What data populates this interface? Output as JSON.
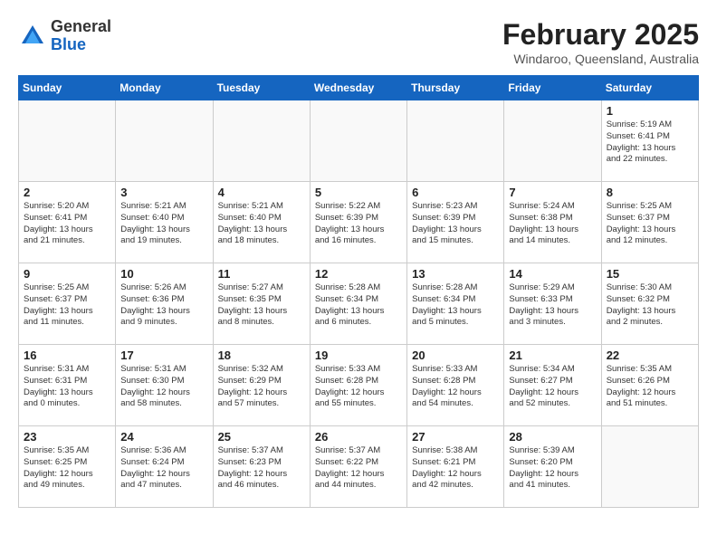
{
  "header": {
    "logo_general": "General",
    "logo_blue": "Blue",
    "month_title": "February 2025",
    "location": "Windaroo, Queensland, Australia"
  },
  "days_of_week": [
    "Sunday",
    "Monday",
    "Tuesday",
    "Wednesday",
    "Thursday",
    "Friday",
    "Saturday"
  ],
  "weeks": [
    [
      {
        "day": "",
        "info": ""
      },
      {
        "day": "",
        "info": ""
      },
      {
        "day": "",
        "info": ""
      },
      {
        "day": "",
        "info": ""
      },
      {
        "day": "",
        "info": ""
      },
      {
        "day": "",
        "info": ""
      },
      {
        "day": "1",
        "info": "Sunrise: 5:19 AM\nSunset: 6:41 PM\nDaylight: 13 hours\nand 22 minutes."
      }
    ],
    [
      {
        "day": "2",
        "info": "Sunrise: 5:20 AM\nSunset: 6:41 PM\nDaylight: 13 hours\nand 21 minutes."
      },
      {
        "day": "3",
        "info": "Sunrise: 5:21 AM\nSunset: 6:40 PM\nDaylight: 13 hours\nand 19 minutes."
      },
      {
        "day": "4",
        "info": "Sunrise: 5:21 AM\nSunset: 6:40 PM\nDaylight: 13 hours\nand 18 minutes."
      },
      {
        "day": "5",
        "info": "Sunrise: 5:22 AM\nSunset: 6:39 PM\nDaylight: 13 hours\nand 16 minutes."
      },
      {
        "day": "6",
        "info": "Sunrise: 5:23 AM\nSunset: 6:39 PM\nDaylight: 13 hours\nand 15 minutes."
      },
      {
        "day": "7",
        "info": "Sunrise: 5:24 AM\nSunset: 6:38 PM\nDaylight: 13 hours\nand 14 minutes."
      },
      {
        "day": "8",
        "info": "Sunrise: 5:25 AM\nSunset: 6:37 PM\nDaylight: 13 hours\nand 12 minutes."
      }
    ],
    [
      {
        "day": "9",
        "info": "Sunrise: 5:25 AM\nSunset: 6:37 PM\nDaylight: 13 hours\nand 11 minutes."
      },
      {
        "day": "10",
        "info": "Sunrise: 5:26 AM\nSunset: 6:36 PM\nDaylight: 13 hours\nand 9 minutes."
      },
      {
        "day": "11",
        "info": "Sunrise: 5:27 AM\nSunset: 6:35 PM\nDaylight: 13 hours\nand 8 minutes."
      },
      {
        "day": "12",
        "info": "Sunrise: 5:28 AM\nSunset: 6:34 PM\nDaylight: 13 hours\nand 6 minutes."
      },
      {
        "day": "13",
        "info": "Sunrise: 5:28 AM\nSunset: 6:34 PM\nDaylight: 13 hours\nand 5 minutes."
      },
      {
        "day": "14",
        "info": "Sunrise: 5:29 AM\nSunset: 6:33 PM\nDaylight: 13 hours\nand 3 minutes."
      },
      {
        "day": "15",
        "info": "Sunrise: 5:30 AM\nSunset: 6:32 PM\nDaylight: 13 hours\nand 2 minutes."
      }
    ],
    [
      {
        "day": "16",
        "info": "Sunrise: 5:31 AM\nSunset: 6:31 PM\nDaylight: 13 hours\nand 0 minutes."
      },
      {
        "day": "17",
        "info": "Sunrise: 5:31 AM\nSunset: 6:30 PM\nDaylight: 12 hours\nand 58 minutes."
      },
      {
        "day": "18",
        "info": "Sunrise: 5:32 AM\nSunset: 6:29 PM\nDaylight: 12 hours\nand 57 minutes."
      },
      {
        "day": "19",
        "info": "Sunrise: 5:33 AM\nSunset: 6:28 PM\nDaylight: 12 hours\nand 55 minutes."
      },
      {
        "day": "20",
        "info": "Sunrise: 5:33 AM\nSunset: 6:28 PM\nDaylight: 12 hours\nand 54 minutes."
      },
      {
        "day": "21",
        "info": "Sunrise: 5:34 AM\nSunset: 6:27 PM\nDaylight: 12 hours\nand 52 minutes."
      },
      {
        "day": "22",
        "info": "Sunrise: 5:35 AM\nSunset: 6:26 PM\nDaylight: 12 hours\nand 51 minutes."
      }
    ],
    [
      {
        "day": "23",
        "info": "Sunrise: 5:35 AM\nSunset: 6:25 PM\nDaylight: 12 hours\nand 49 minutes."
      },
      {
        "day": "24",
        "info": "Sunrise: 5:36 AM\nSunset: 6:24 PM\nDaylight: 12 hours\nand 47 minutes."
      },
      {
        "day": "25",
        "info": "Sunrise: 5:37 AM\nSunset: 6:23 PM\nDaylight: 12 hours\nand 46 minutes."
      },
      {
        "day": "26",
        "info": "Sunrise: 5:37 AM\nSunset: 6:22 PM\nDaylight: 12 hours\nand 44 minutes."
      },
      {
        "day": "27",
        "info": "Sunrise: 5:38 AM\nSunset: 6:21 PM\nDaylight: 12 hours\nand 42 minutes."
      },
      {
        "day": "28",
        "info": "Sunrise: 5:39 AM\nSunset: 6:20 PM\nDaylight: 12 hours\nand 41 minutes."
      },
      {
        "day": "",
        "info": ""
      }
    ]
  ]
}
